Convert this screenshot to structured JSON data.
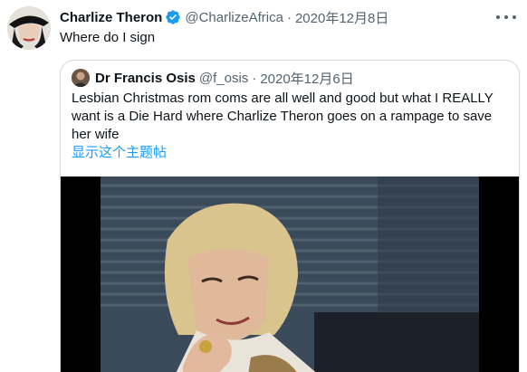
{
  "tweet": {
    "author_name": "Charlize Theron",
    "handle": "@CharlizeAfrica",
    "separator": "·",
    "date": "2020年12月8日",
    "text": "Where do I sign",
    "verified_icon": "verified-badge-icon",
    "accent_color": "#1d9bf0"
  },
  "quoted_tweet": {
    "author_name": "Dr Francis Osis",
    "handle": "@f_osis",
    "separator": "·",
    "date": "2020年12月6日",
    "text": "Lesbian Christmas rom coms are all well and good but what I REALLY want is a Die Hard where Charlize Theron goes on a rampage to save her wife",
    "show_thread_link": "显示这个主题帖"
  },
  "icons": {
    "more": "more-options-icon",
    "media": "video-thumbnail"
  }
}
